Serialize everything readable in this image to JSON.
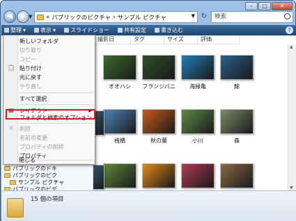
{
  "window": {
    "caption": {
      "minimize": "–",
      "maximize": "□",
      "close": "✕"
    }
  },
  "address": {
    "path_prefix": "«",
    "path_part1": "パブリックのピクチャ",
    "path_sep": "›",
    "path_part2": "サンプル ピクチャ",
    "search_placeholder": "検索"
  },
  "toolbar": {
    "organize": "整理",
    "views": "表示",
    "slideshow": "スライドショー",
    "share": "共有設定",
    "burn": "書き込む"
  },
  "columns": [
    "撮影日",
    "タグ",
    "サイズ",
    "評価"
  ],
  "thumbnails": [
    {
      "label": "オオハシ",
      "color": "#3c6b2e"
    },
    {
      "label": "フランジパニ",
      "color": "#2f4f2a"
    },
    {
      "label": "海緑亀",
      "color": "#1e7fb3"
    },
    {
      "label": "鯨",
      "color": "#2a5f8c"
    },
    {
      "label": "桟橋",
      "color": "#4d86b8"
    },
    {
      "label": "秋の葉",
      "color": "#c95b1c"
    },
    {
      "label": "小川",
      "color": "#5e8a45"
    },
    {
      "label": "森",
      "color": "#7a8a6a"
    },
    {
      "label": "",
      "color": "#5f8a3a"
    },
    {
      "label": "",
      "color": "#e08a15"
    },
    {
      "label": "",
      "color": "#b13a52"
    },
    {
      "label": "",
      "color": "#8a6a45"
    }
  ],
  "nav_pane": {
    "item1": "パブリックのドキ",
    "item2": "パブリックのピク",
    "item3": "サンプル ピクチャ",
    "item4": "パブリックのビデ"
  },
  "status": {
    "count_text": "15 個の項目"
  },
  "menu": {
    "new_folder": "新しいフォルダ",
    "cut": "切り取り",
    "copy": "コピー",
    "paste": "貼り付け",
    "undo": "元に戻す",
    "redo": "やり直し",
    "select_all": "すべて選択",
    "layout": "レイアウト",
    "folder_options": "フォルダと検索のオプション",
    "delete": "削除",
    "rename": "名前の変更",
    "remove_properties": "プロパティの削除",
    "properties": "プロパティ",
    "close": "閉じる"
  },
  "colors": {
    "highlight": "#e0181e"
  }
}
